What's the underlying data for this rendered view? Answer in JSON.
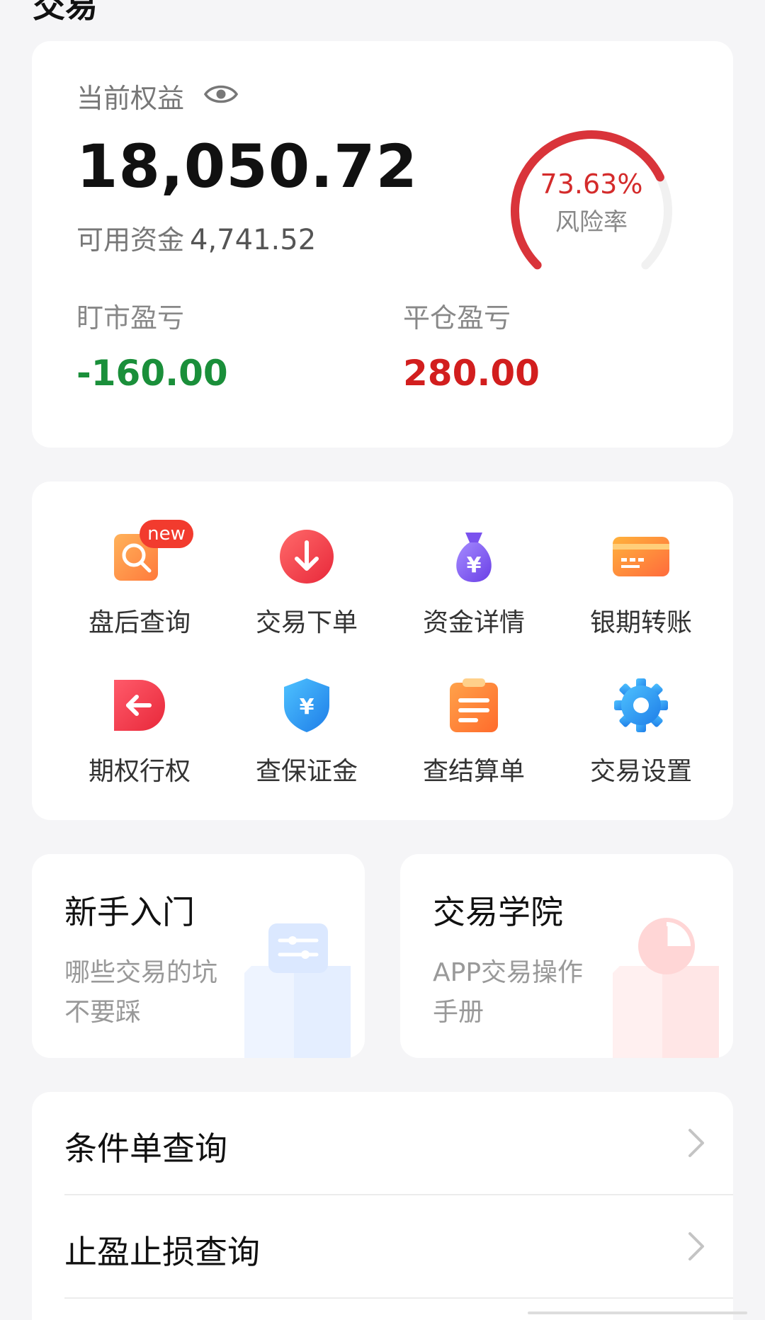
{
  "header": {
    "title": "交易"
  },
  "equity": {
    "label": "当前权益",
    "value": "18,050.72",
    "available_label": "可用资金",
    "available_value": "4,741.52",
    "risk_rate": "73.63%",
    "risk_rate_fraction": 0.7363,
    "risk_label": "风险率",
    "floating_pl_label": "盯市盈亏",
    "floating_pl_value": "-160.00",
    "closed_pl_label": "平仓盈亏",
    "closed_pl_value": "280.00"
  },
  "grid": {
    "items": [
      {
        "label": "盘后查询",
        "icon": "search-doc-icon",
        "badge": "new"
      },
      {
        "label": "交易下单",
        "icon": "down-arrow-circle-icon"
      },
      {
        "label": "资金详情",
        "icon": "money-bag-icon"
      },
      {
        "label": "银期转账",
        "icon": "bank-card-icon"
      },
      {
        "label": "期权行权",
        "icon": "back-arrow-icon"
      },
      {
        "label": "查保证金",
        "icon": "shield-yen-icon"
      },
      {
        "label": "查结算单",
        "icon": "clipboard-icon"
      },
      {
        "label": "交易设置",
        "icon": "gear-icon"
      }
    ]
  },
  "promos": [
    {
      "title": "新手入门",
      "subtitle": "哪些交易的坑不要踩"
    },
    {
      "title": "交易学院",
      "subtitle": "APP交易操作手册"
    }
  ],
  "list": [
    {
      "label": "条件单查询"
    },
    {
      "label": "止盈止损查询"
    }
  ],
  "colors": {
    "accent_red": "#d21e1e",
    "loss_green": "#1a8f3a",
    "gauge_track": "#f1f1f1"
  }
}
